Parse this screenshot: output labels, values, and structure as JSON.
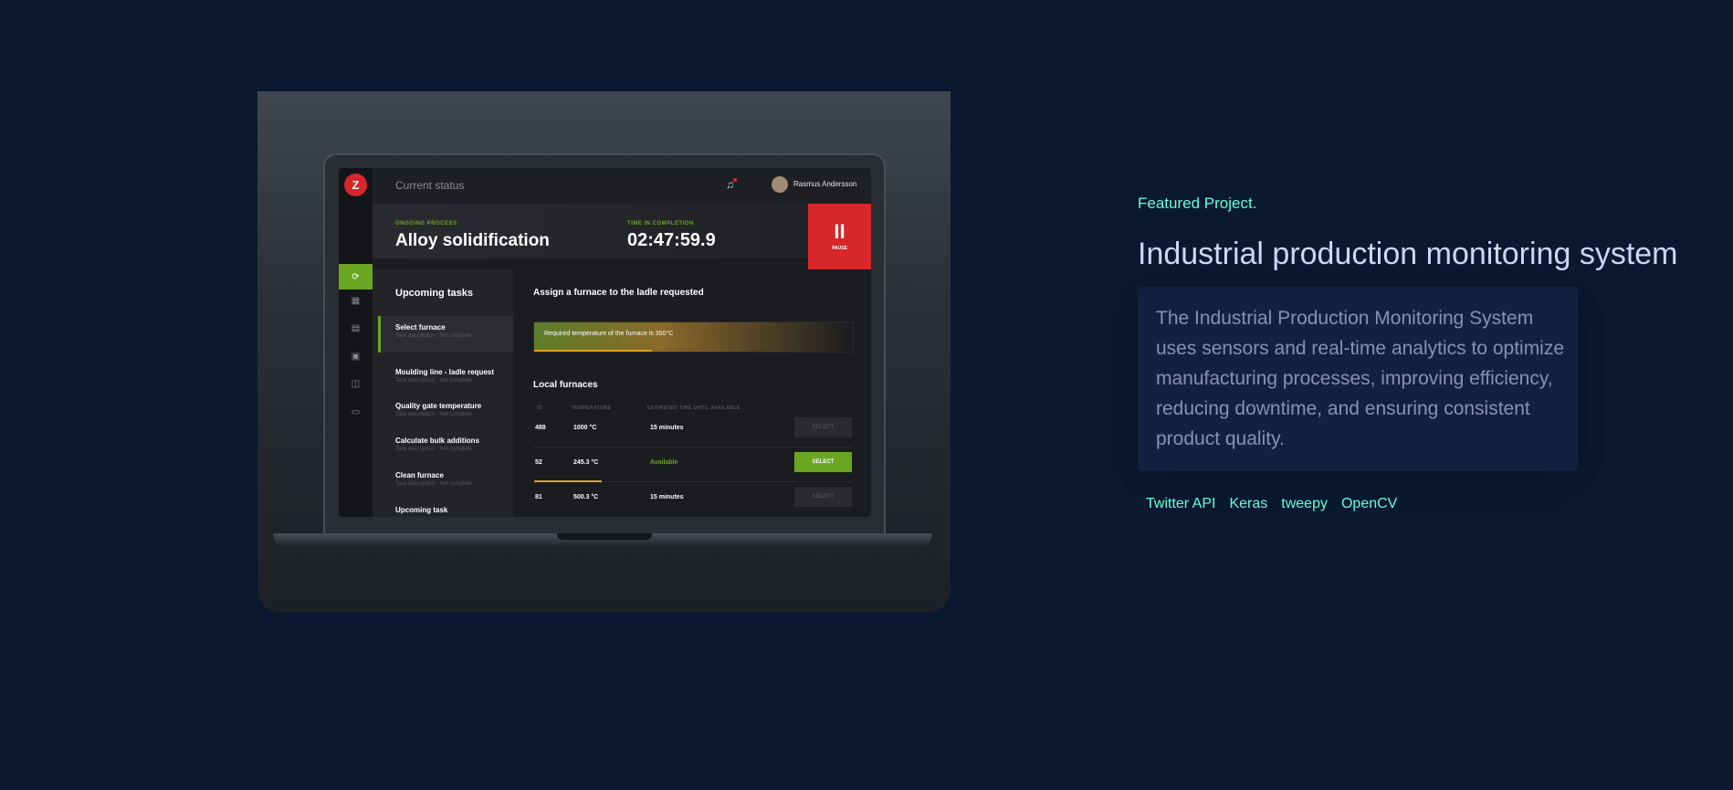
{
  "project": {
    "overline": "Featured Project.",
    "title": "Industrial production monitoring system",
    "description": "The Industrial Production Monitoring System uses sensors and real-time analytics to optimize manufacturing processes, improving efficiency, reducing downtime, and ensuring consistent product quality.",
    "tech": [
      "Twitter API",
      "Keras",
      "tweepy",
      "OpenCV"
    ]
  },
  "screen": {
    "title": "Current status",
    "user_name": "Rasmus Andersson",
    "ongoing_label": "ONGOING PROCESS",
    "ongoing_value": "Alloy solidification",
    "time_label": "TIME IN COMPLETION",
    "time_value": "02:47:59.9",
    "pause_icon": "II",
    "pause_label": "PAUSE",
    "tasks_title": "Upcoming tasks",
    "tasks": [
      {
        "name": "Select furnace",
        "meta": "Task description · Not complete"
      },
      {
        "name": "Moulding line - ladle request",
        "meta": "Task description · Not complete"
      },
      {
        "name": "Quality gate temperature",
        "meta": "Task description · Not complete"
      },
      {
        "name": "Calculate bulk additions",
        "meta": "Task description · Not complete"
      },
      {
        "name": "Clean furnace",
        "meta": "Task description · Not complete"
      },
      {
        "name": "Upcoming task",
        "meta": ""
      }
    ],
    "assign_title": "Assign a furnace to the ladle requested",
    "temp_text": "Required temperature of the furnace is 350°C",
    "temp_progress": 0.37,
    "furnaces_title": "Local furnaces",
    "columns": [
      "ID",
      "TEMPERATURE",
      "ESTIMATED TIME UNTIL AVAILABLE"
    ],
    "furnaces": [
      {
        "id": "488",
        "temp": "1000 °C",
        "eta": "15 minutes",
        "button": "SELECT"
      },
      {
        "id": "52",
        "temp": "245.3 °C",
        "eta": "Available",
        "button": "SELECT"
      },
      {
        "id": "81",
        "temp": "500.3 °C",
        "eta": "15 minutes",
        "button": "SELECT"
      }
    ],
    "colors": {
      "accent_green": "#6aa622",
      "alert_red": "#d8272b"
    }
  },
  "colors": {
    "background": "#0a192f",
    "accent": "#64ffda",
    "title": "#ccd6f6",
    "body": "#8892b0",
    "card": "#112240"
  }
}
